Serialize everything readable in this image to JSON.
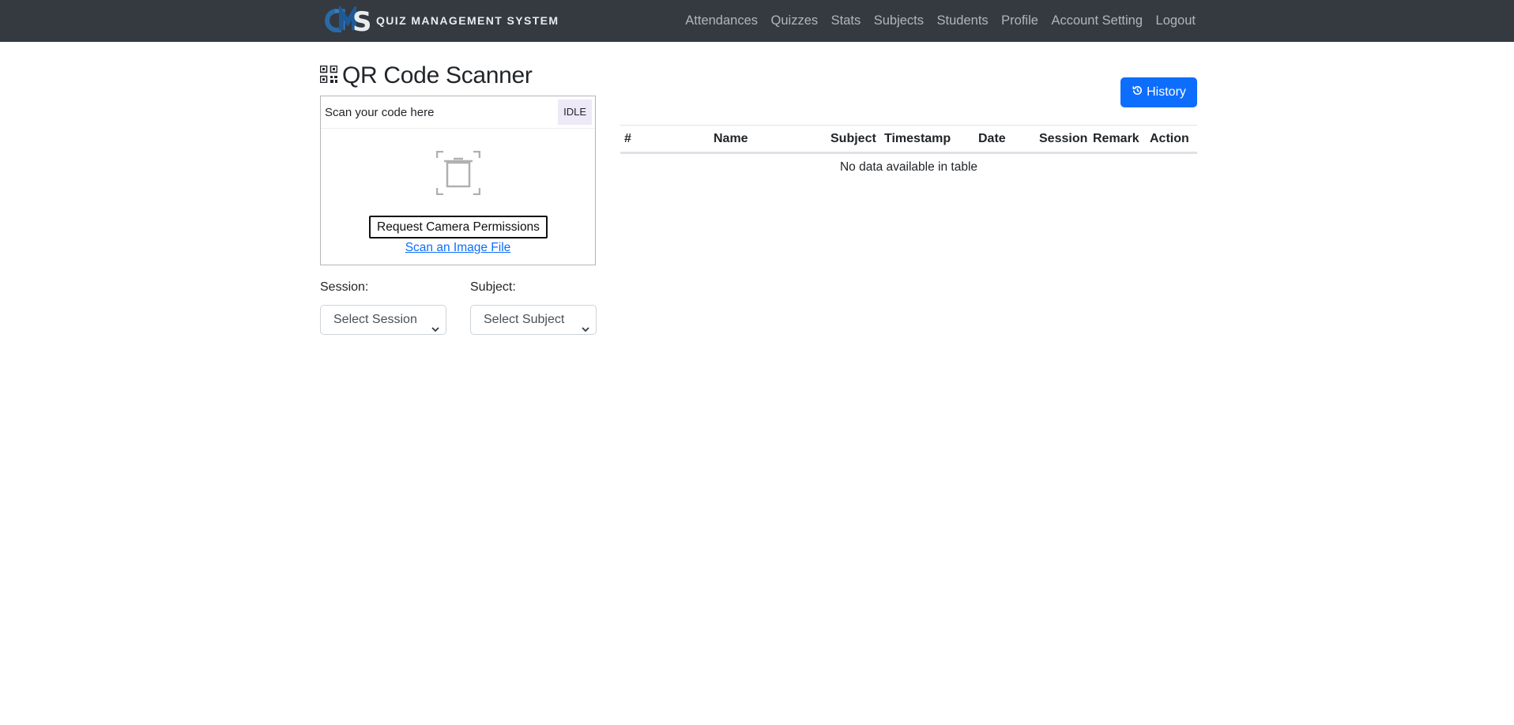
{
  "brand": {
    "logo_letters": "QMS",
    "name": "QUIZ MANAGEMENT SYSTEM"
  },
  "nav": {
    "items": [
      {
        "label": "Attendances"
      },
      {
        "label": "Quizzes"
      },
      {
        "label": "Stats"
      },
      {
        "label": "Subjects"
      },
      {
        "label": "Students"
      },
      {
        "label": "Profile"
      },
      {
        "label": "Account Setting"
      },
      {
        "label": "Logout"
      }
    ]
  },
  "page": {
    "title": "QR Code Scanner",
    "title_icon": "qrcode-icon"
  },
  "scanner": {
    "header_text": "Scan your code here",
    "status": "IDLE",
    "scan_region_icon": "camera-scan-icon",
    "permission_button": "Request Camera Permissions",
    "file_link": "Scan an Image File"
  },
  "form": {
    "session_label": "Session:",
    "session_value": "Select Session",
    "subject_label": "Subject:",
    "subject_value": "Select Subject"
  },
  "history_button": {
    "label": "History",
    "icon": "history-icon"
  },
  "table": {
    "columns": [
      "#",
      "Name",
      "Subject",
      "Timestamp",
      "Date",
      "Session",
      "Remark",
      "Action"
    ],
    "empty_message": "No data available in table"
  },
  "colors": {
    "navbar_bg": "#343a40",
    "primary": "#0d6efd",
    "logo_blue": "#2a6fb0"
  }
}
